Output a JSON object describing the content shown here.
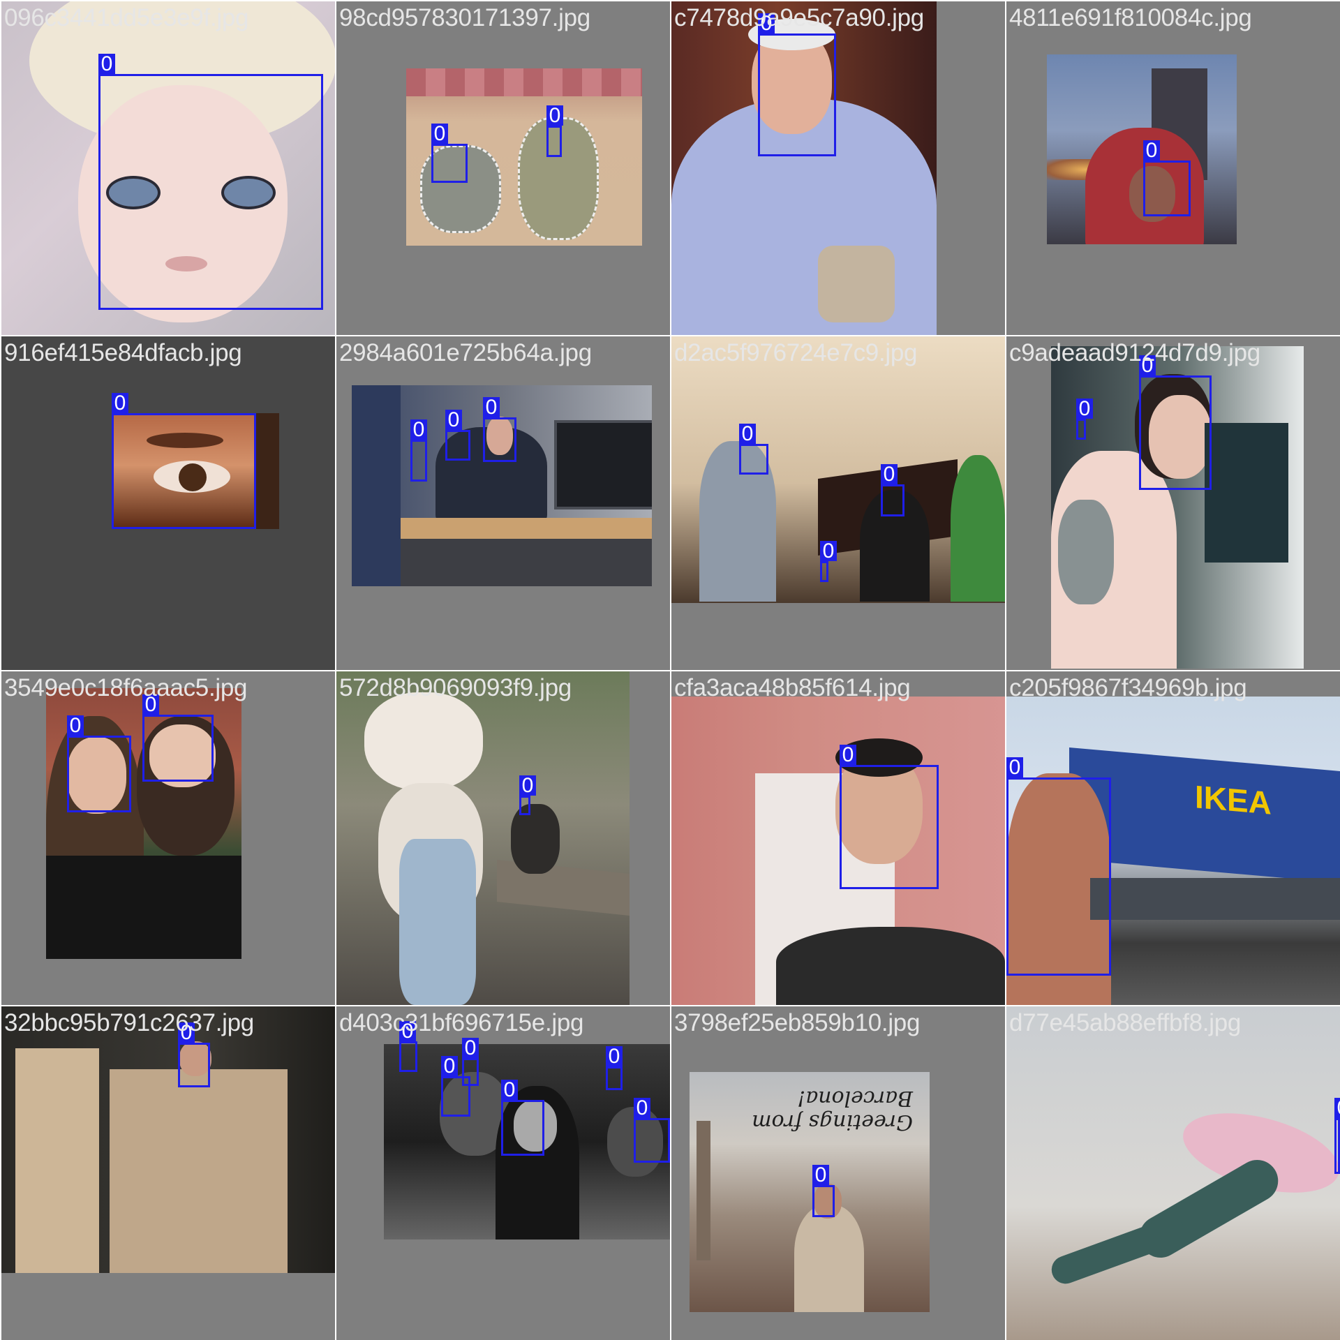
{
  "colors": {
    "box": "#1f1fe8",
    "label_text": "#ffffff",
    "filename_text": "#e6e6e6",
    "tile_bg": "#7f7f7f"
  },
  "tiles": [
    {
      "filename": "096c3441dd5e3e9f.jpg",
      "label": "0",
      "scene": "doll-face"
    },
    {
      "filename": "98cd957830171397.jpg",
      "label": "0",
      "scene": "muppets-poster"
    },
    {
      "filename": "c7478d9a9e5c7a90.jpg",
      "label": "0",
      "scene": "elderly-man"
    },
    {
      "filename": "4811e691f810084c.jpg",
      "label": "0",
      "scene": "red-hood"
    },
    {
      "filename": "916ef415e84dfacb.jpg",
      "label": "0",
      "scene": "eye-closeup"
    },
    {
      "filename": "2984a601e725b64a.jpg",
      "label": "0",
      "scene": "conference"
    },
    {
      "filename": "d2ac5f976724e7c9.jpg",
      "label": "0",
      "scene": "piano-room"
    },
    {
      "filename": "c9adeaad9124d7d9.jpg",
      "label": "0",
      "scene": "tattoo-woman"
    },
    {
      "filename": "3549e0c18f6aaac5.jpg",
      "label": "0",
      "scene": "two-friends"
    },
    {
      "filename": "572d8b9069093f9.jpg",
      "label": "0",
      "scene": "bunny-statue"
    },
    {
      "filename": "cfa3aca48b85f614.jpg",
      "label": "0",
      "scene": "glasses-man"
    },
    {
      "filename": "c205f9867f34969b.jpg",
      "label": "0",
      "scene": "ikea-selfie",
      "sign": "IKEA"
    },
    {
      "filename": "32bbc95b791c2637.jpg",
      "label": "0",
      "scene": "cardboard-box"
    },
    {
      "filename": "d403c31bf696715e.jpg",
      "label": "0",
      "scene": "bw-crowd"
    },
    {
      "filename": "3798ef25eb859b10.jpg",
      "label": "0",
      "scene": "barcelona-postcard",
      "postcard_text": "Greetings from Barcelona!"
    },
    {
      "filename": "d77e45ab88effbf8.jpg",
      "label": "0",
      "scene": "yoga-pose"
    }
  ]
}
